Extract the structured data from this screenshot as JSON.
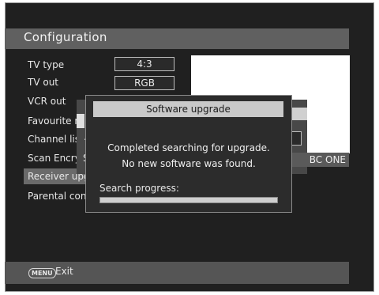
{
  "header": {
    "title": "Configuration"
  },
  "menu": {
    "items": [
      {
        "label": "TV type"
      },
      {
        "label": "TV out"
      },
      {
        "label": "VCR out"
      },
      {
        "label": "Favourite n"
      },
      {
        "label": "Channel lis"
      },
      {
        "label": "Scan Encry"
      },
      {
        "label": "Receiver upgr"
      },
      {
        "label": "Parental contr"
      }
    ],
    "selected_index": 6
  },
  "values": {
    "tv_type": "4:3",
    "tv_out": "RGB"
  },
  "background": {
    "channel_text": "BC ONE",
    "left_letter_b": "A",
    "left_letter_c": "S"
  },
  "dialog": {
    "title": "Software upgrade",
    "message_line1": "Completed searching for upgrade.",
    "message_line2": "No new software was found.",
    "progress_label": "Search progress:",
    "progress_percent": 100
  },
  "footer": {
    "menu_key": "MENU",
    "exit_label": "Exit"
  },
  "colors": {
    "screen_bg": "#202020",
    "bar_gray": "#606060",
    "dialog_title_bg": "#c9c9c9"
  }
}
